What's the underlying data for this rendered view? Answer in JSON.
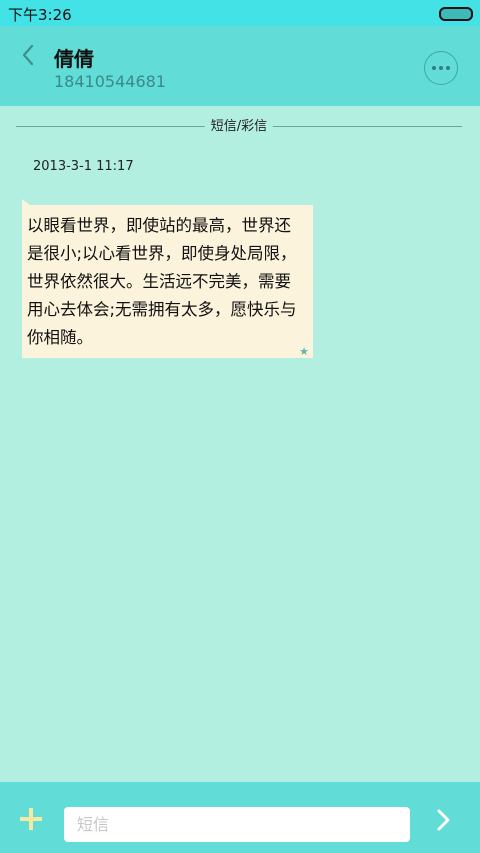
{
  "status_bar": {
    "time": "下午3:26",
    "battery_icon": "battery-icon"
  },
  "header": {
    "back_icon": "chevron-left-icon",
    "contact_name": "倩倩",
    "contact_number": "18410544681",
    "more_icon": "more-dots-icon"
  },
  "conversation": {
    "section_label": "短信/彩信",
    "messages": [
      {
        "timestamp": "2013-3-1 11:17",
        "text": "以眼看世界，即使站的最高，世界还是很小;以心看世界，即使身处局限，世界依然很大。生活远不完美，需要用心去体会;无需拥有太多，愿快乐与你相随。",
        "status_icon": "star-icon"
      }
    ]
  },
  "composer": {
    "add_icon": "plus-icon",
    "placeholder": "短信",
    "value": "",
    "send_icon": "chevron-right-icon"
  },
  "colors": {
    "status_bar": "#43e2e6",
    "header": "#62dcd6",
    "background": "#b2efe1",
    "bubble": "#fbf3dc",
    "accent_plus": "#f5e9a4"
  }
}
